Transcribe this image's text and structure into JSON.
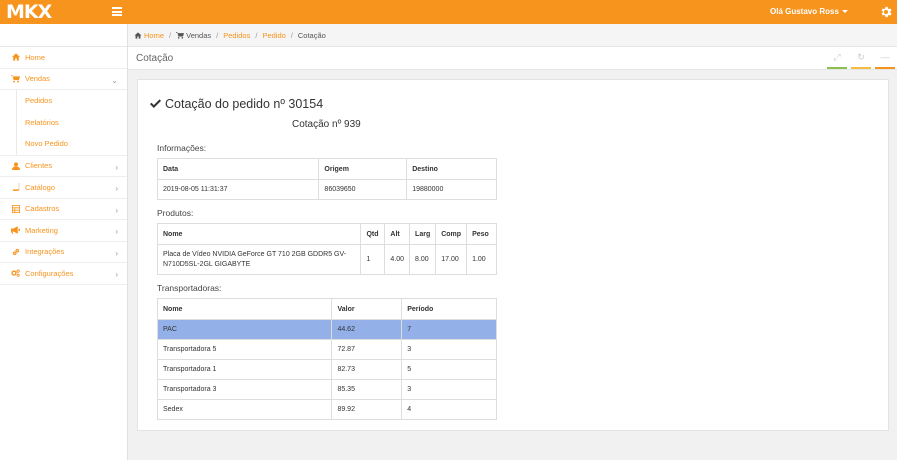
{
  "topbar": {
    "logo": "MKX",
    "user": "Olá Gustavo Ross",
    "accent": "#f7941d"
  },
  "sidebar": {
    "items": [
      {
        "label": "Home",
        "icon": "home-icon"
      },
      {
        "label": "Vendas",
        "icon": "cart-icon",
        "expanded": true,
        "children": [
          "Pedidos",
          "Relatórios",
          "Novo Pedido"
        ]
      },
      {
        "label": "Clientes",
        "icon": "user-icon"
      },
      {
        "label": "Catálogo",
        "icon": "book-icon"
      },
      {
        "label": "Cadastros",
        "icon": "table-icon"
      },
      {
        "label": "Marketing",
        "icon": "bullhorn-icon"
      },
      {
        "label": "Integrações",
        "icon": "link-icon"
      },
      {
        "label": "Configurações",
        "icon": "cogs-icon"
      }
    ]
  },
  "breadcrumb": {
    "home": "Home",
    "vendas": "Vendas",
    "pedidos": "Pedidos",
    "pedido": "Pedido",
    "current": "Cotação"
  },
  "page": {
    "title": "Cotação"
  },
  "card": {
    "title": "Cotação do pedido nº 30154",
    "subtitle": "Cotação nº 939",
    "info_label": "Informações:",
    "info_headers": [
      "Data",
      "Origem",
      "Destino"
    ],
    "info_row": [
      "2019-08-05 11:31:37",
      "86039650",
      "19880000"
    ],
    "products_label": "Produtos:",
    "product_headers": [
      "Nome",
      "Qtd",
      "Alt",
      "Larg",
      "Comp",
      "Peso"
    ],
    "product_rows": [
      [
        "Placa de Vídeo NVIDIA GeForce GT 710 2GB GDDR5 GV-N710D5SL-2GL GIGABYTE",
        "1",
        "4.00",
        "8.00",
        "17.00",
        "1.00"
      ]
    ],
    "carriers_label": "Transportadoras:",
    "carrier_headers": [
      "Nome",
      "Valor",
      "Período"
    ],
    "carrier_rows": [
      [
        "PAC",
        "44.62",
        "7"
      ],
      [
        "Transportadora 5",
        "72.87",
        "3"
      ],
      [
        "Transportadora 1",
        "82.73",
        "5"
      ],
      [
        "Transportadora 3",
        "85.35",
        "3"
      ],
      [
        "Sedex",
        "89.92",
        "4"
      ]
    ],
    "highlight_color": "#94b0e8"
  }
}
